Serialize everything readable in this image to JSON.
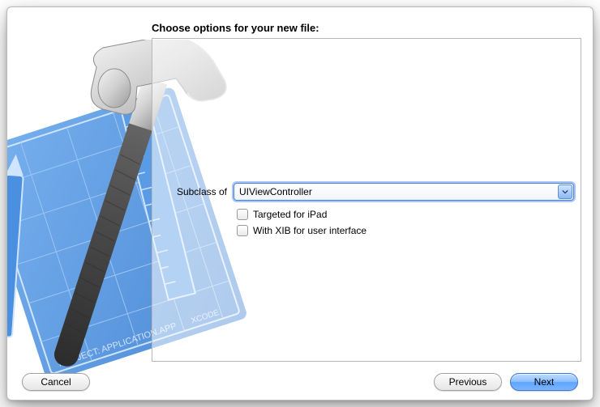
{
  "header": {
    "title": "Choose options for your new file:"
  },
  "form": {
    "subclass_label": "Subclass of",
    "subclass_value": "UIViewController",
    "option_ipad": "Targeted for iPad",
    "option_xib": "With XIB for user interface"
  },
  "footer": {
    "cancel": "Cancel",
    "previous": "Previous",
    "next": "Next"
  },
  "icons": {
    "dropdown": "chevron-down-icon",
    "background": "xcode-hammer-blueprint"
  },
  "colors": {
    "focus_ring": "#a6c6ff",
    "primary_button": "#7ab5ff",
    "panel_border": "#b8b8b8"
  }
}
